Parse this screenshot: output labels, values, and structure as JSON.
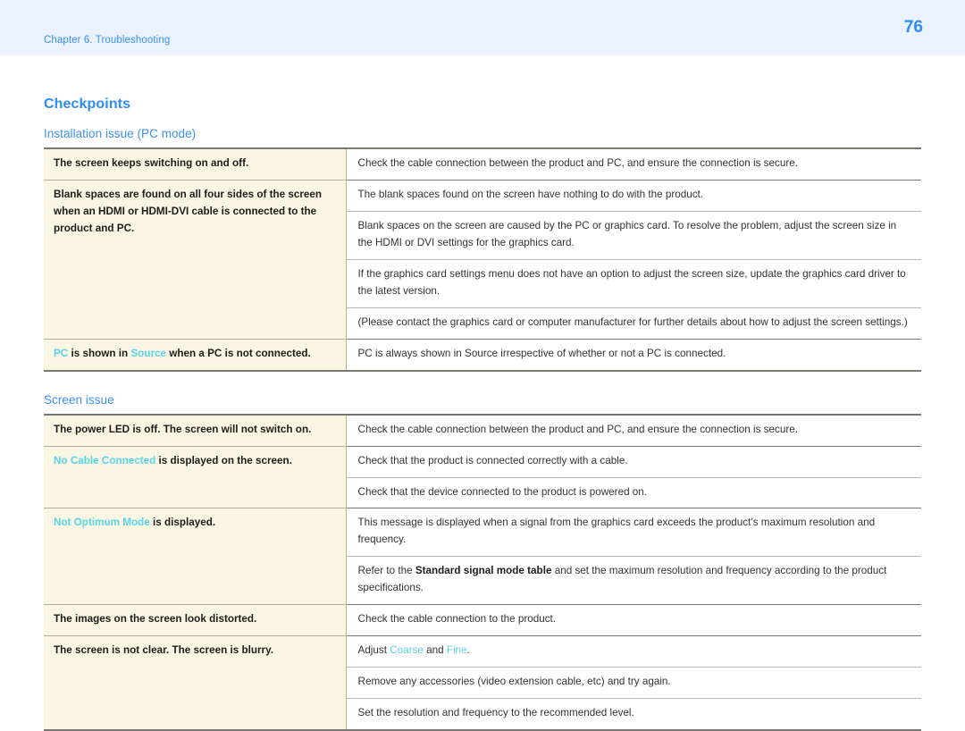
{
  "header": {
    "chapter": "Chapter 6. Troubleshooting",
    "page_number": "76",
    "band_color": "#e9f2fd",
    "accent_color": "#2e8cf5"
  },
  "page": {
    "section_title": "Checkpoints",
    "highlight_color": "#59d3e8",
    "symptom_column_bg": "#faf6e4"
  },
  "sections": [
    {
      "title": "Installation issue (PC mode)",
      "rows": [
        {
          "symptom_parts": [
            {
              "text": "The screen keeps switching on and off.",
              "style": "plain"
            }
          ],
          "solutions": [
            [
              {
                "text": "Check the cable connection between the product and PC, and ensure the connection is secure.",
                "style": "plain"
              }
            ]
          ]
        },
        {
          "symptom_parts": [
            {
              "text": "Blank spaces are found on all four sides of the screen when an HDMI or HDMI-DVI cable is connected to the product and PC.",
              "style": "plain"
            }
          ],
          "solutions": [
            [
              {
                "text": "The blank spaces found on the screen have nothing to do with the product.",
                "style": "plain"
              }
            ],
            [
              {
                "text": "Blank spaces on the screen are caused by the PC or graphics card. To resolve the problem, adjust the screen size in the HDMI or DVI settings for the graphics card.",
                "style": "plain"
              }
            ],
            [
              {
                "text": "If the graphics card settings menu does not have an option to adjust the screen size, update the graphics card driver to the latest version.",
                "style": "plain"
              }
            ],
            [
              {
                "text": "(Please contact the graphics card or computer manufacturer for further details about how to adjust the screen settings.)",
                "style": "plain"
              }
            ]
          ]
        },
        {
          "symptom_parts": [
            {
              "text": "PC",
              "style": "highlight"
            },
            {
              "text": " is shown in ",
              "style": "plain"
            },
            {
              "text": "Source",
              "style": "highlight"
            },
            {
              "text": " when a PC is not connected.",
              "style": "plain"
            }
          ],
          "solutions": [
            [
              {
                "text": "PC is always shown in Source irrespective of whether or not a PC is connected.",
                "style": "plain"
              }
            ]
          ]
        }
      ]
    },
    {
      "title": "Screen issue",
      "rows": [
        {
          "symptom_parts": [
            {
              "text": "The power LED is off. The screen will not switch on.",
              "style": "plain"
            }
          ],
          "solutions": [
            [
              {
                "text": "Check the cable connection between the product and PC, and ensure the connection is secure.",
                "style": "plain"
              }
            ]
          ]
        },
        {
          "symptom_parts": [
            {
              "text": "No Cable Connected",
              "style": "highlight"
            },
            {
              "text": " is displayed on the screen.",
              "style": "plain"
            }
          ],
          "solutions": [
            [
              {
                "text": "Check that the product is connected correctly with a cable.",
                "style": "plain"
              }
            ],
            [
              {
                "text": "Check that the device connected to the product is powered on.",
                "style": "plain"
              }
            ]
          ]
        },
        {
          "symptom_parts": [
            {
              "text": "Not Optimum Mode",
              "style": "highlight"
            },
            {
              "text": " is displayed.",
              "style": "plain"
            }
          ],
          "solutions": [
            [
              {
                "text": "This message is displayed when a signal from the graphics card exceeds the product’s maximum resolution and frequency.",
                "style": "plain"
              }
            ],
            [
              {
                "text": "Refer to the ",
                "style": "plain"
              },
              {
                "text": "Standard signal mode table",
                "style": "bold"
              },
              {
                "text": " and set the maximum resolution and frequency according to the product specifications.",
                "style": "plain"
              }
            ]
          ]
        },
        {
          "symptom_parts": [
            {
              "text": "The images on the screen look distorted.",
              "style": "plain"
            }
          ],
          "solutions": [
            [
              {
                "text": "Check the cable connection to the product.",
                "style": "plain"
              }
            ]
          ]
        },
        {
          "symptom_parts": [
            {
              "text": "The screen is not clear. The screen is blurry.",
              "style": "plain"
            }
          ],
          "solutions": [
            [
              {
                "text": "Adjust ",
                "style": "plain"
              },
              {
                "text": "Coarse",
                "style": "highlight-thin"
              },
              {
                "text": " and ",
                "style": "plain"
              },
              {
                "text": "Fine",
                "style": "highlight-thin"
              },
              {
                "text": ".",
                "style": "plain"
              }
            ],
            [
              {
                "text": "Remove any accessories (video extension cable, etc) and try again.",
                "style": "plain"
              }
            ],
            [
              {
                "text": "Set the resolution and frequency to the recommended level.",
                "style": "plain"
              }
            ]
          ]
        }
      ]
    }
  ]
}
